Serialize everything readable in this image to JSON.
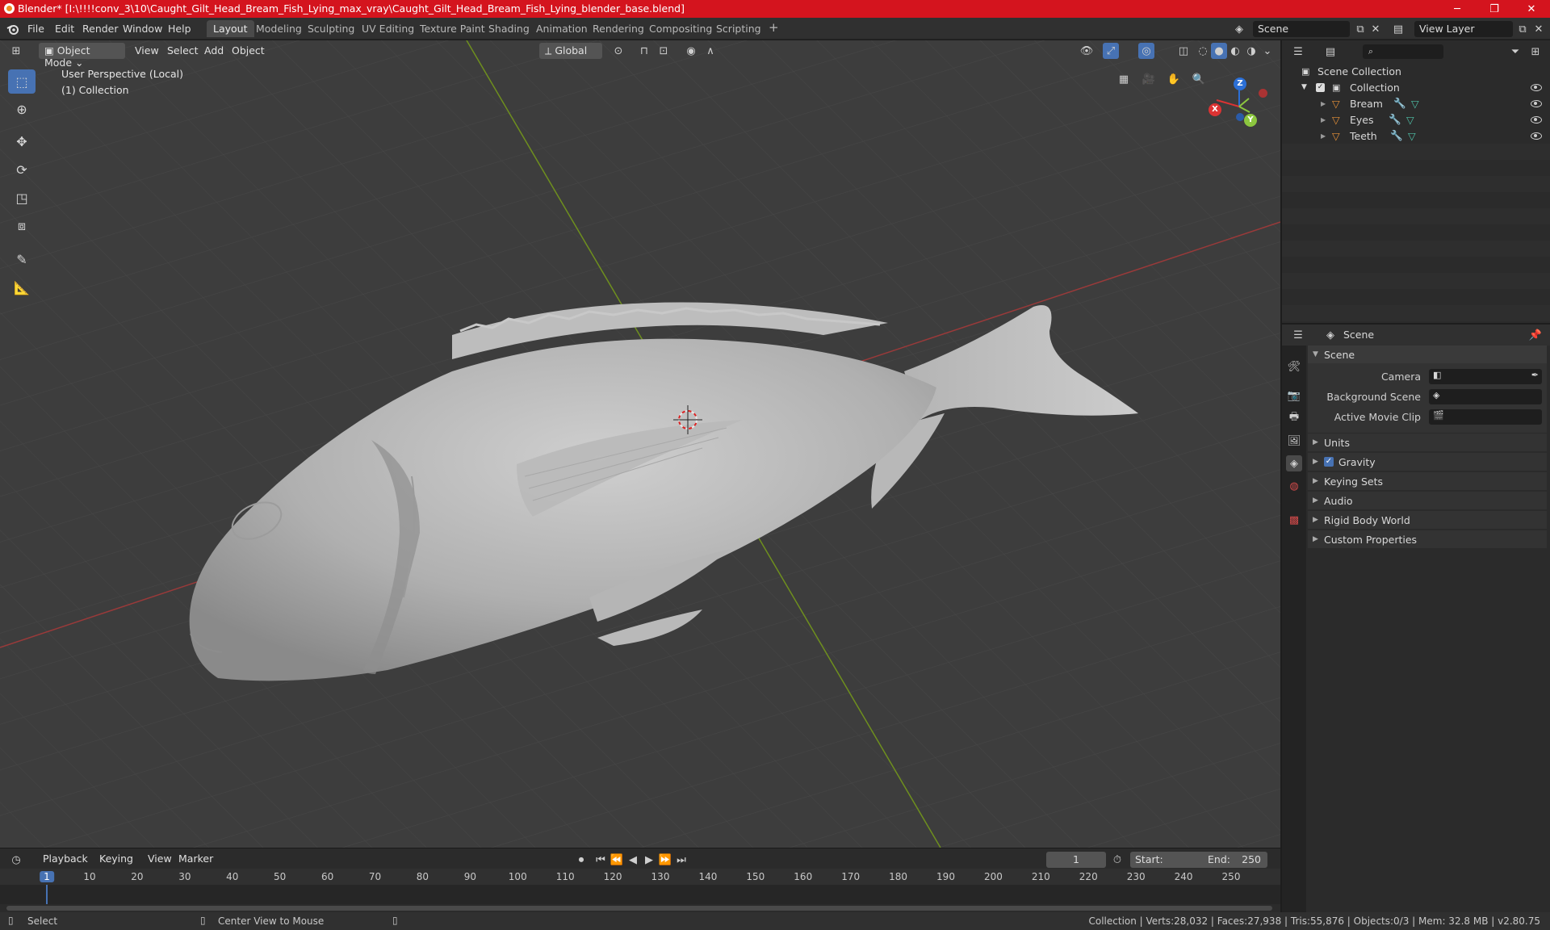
{
  "window": {
    "title": "Blender* [I:\\!!!!conv_3\\10\\Caught_Gilt_Head_Bream_Fish_Lying_max_vray\\Caught_Gilt_Head_Bream_Fish_Lying_blender_base.blend]",
    "minimize": "─",
    "maximize": "❐",
    "close": "✕"
  },
  "menubar": {
    "menus": [
      "File",
      "Edit",
      "Render",
      "Window",
      "Help"
    ],
    "workspaces": [
      "Layout",
      "Modeling",
      "Sculpting",
      "UV Editing",
      "Texture Paint",
      "Shading",
      "Animation",
      "Rendering",
      "Compositing",
      "Scripting"
    ],
    "active_workspace": "Layout",
    "add_workspace": "+",
    "scene": "Scene",
    "view_layer": "View Layer"
  },
  "viewport": {
    "mode": "Object Mode",
    "menus": [
      "View",
      "Select",
      "Add",
      "Object"
    ],
    "transform_orientation": "Global",
    "perspective_label": "User Perspective (Local)",
    "collection_label": "(1) Collection",
    "gizmo": {
      "x": "X",
      "y": "Y",
      "z": "Z"
    }
  },
  "outliner": {
    "search_placeholder": "",
    "root": "Scene Collection",
    "collection": "Collection",
    "objects": [
      "Bream",
      "Eyes",
      "Teeth"
    ]
  },
  "properties": {
    "header": "Scene",
    "panel": "Scene",
    "fields": [
      {
        "label": "Camera",
        "value": ""
      },
      {
        "label": "Background Scene",
        "value": ""
      },
      {
        "label": "Active Movie Clip",
        "value": ""
      }
    ],
    "sections": [
      "Units",
      "Gravity",
      "Keying Sets",
      "Audio",
      "Rigid Body World",
      "Custom Properties"
    ],
    "gravity_checked": true
  },
  "timeline": {
    "menus": [
      "Playback",
      "Keying",
      "View",
      "Marker"
    ],
    "current_frame": "1",
    "start_label": "Start:",
    "start": "1",
    "end_label": "End:",
    "end": "250",
    "ticks": [
      "1",
      "10",
      "20",
      "30",
      "40",
      "50",
      "60",
      "70",
      "80",
      "90",
      "100",
      "110",
      "120",
      "130",
      "140",
      "150",
      "160",
      "170",
      "180",
      "190",
      "200",
      "210",
      "220",
      "230",
      "240",
      "250"
    ]
  },
  "status": {
    "left_action": "Select",
    "middle_action": "Center View to Mouse",
    "stats": "Collection | Verts:28,032 | Faces:27,938 | Tris:55,876 | Objects:0/3 | Mem: 32.8 MB | v2.80.75"
  }
}
